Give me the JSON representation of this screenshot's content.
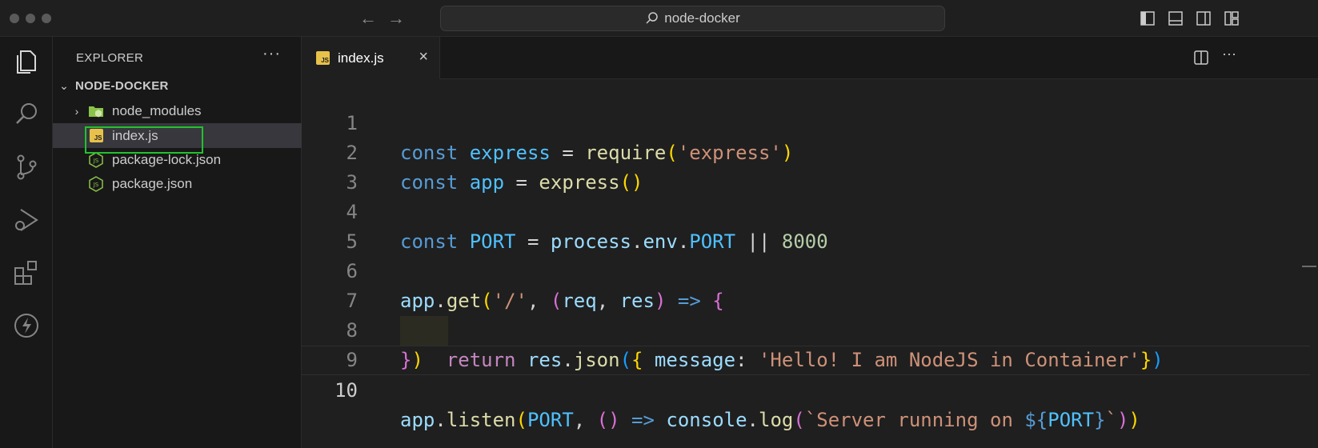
{
  "titlebar": {
    "search_text": "node-docker",
    "back_icon": "arrow-left-icon",
    "forward_icon": "arrow-right-icon"
  },
  "activity_bar": [
    "explorer-icon",
    "search-icon",
    "source-control-icon",
    "run-debug-icon",
    "extensions-icon",
    "thunder-client-icon"
  ],
  "sidebar": {
    "title": "EXPLORER",
    "more": "···",
    "root": "NODE-DOCKER",
    "items": [
      {
        "label": "node_modules",
        "type": "folder"
      },
      {
        "label": "index.js",
        "type": "js",
        "selected": true
      },
      {
        "label": "package-lock.json",
        "type": "json"
      },
      {
        "label": "package.json",
        "type": "json"
      }
    ]
  },
  "tabs": [
    {
      "label": "index.js",
      "close": "×"
    }
  ],
  "editor": {
    "line_numbers": [
      "1",
      "2",
      "3",
      "4",
      "5",
      "6",
      "7",
      "8",
      "9",
      "10"
    ],
    "current_line": 10
  },
  "colors": {
    "highlight_box": "#22c22e",
    "background": "#1f1f1f",
    "sidebar": "#181818"
  }
}
